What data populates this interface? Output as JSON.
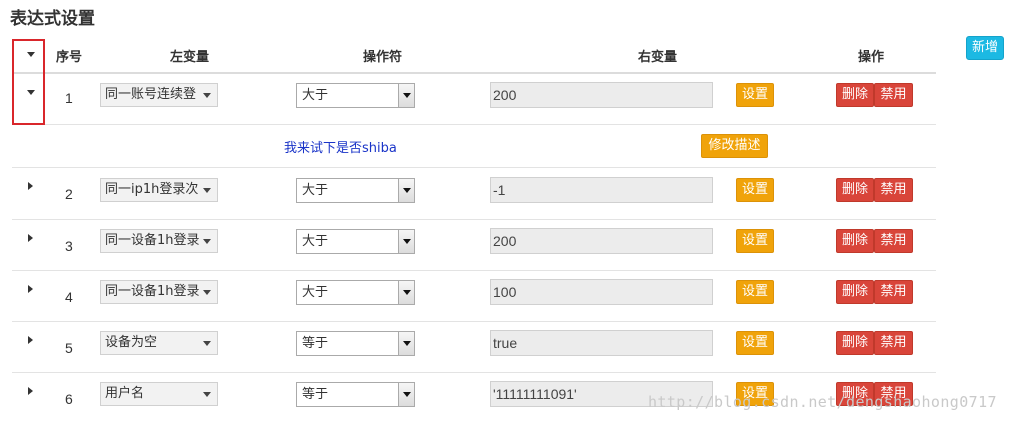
{
  "page": {
    "title": "表达式设置",
    "new_button": "新增"
  },
  "table": {
    "headers": {
      "index": "序号",
      "left": "左变量",
      "operator": "操作符",
      "right": "右变量",
      "action": "操作"
    },
    "rows": [
      {
        "index": "1",
        "left": "同一账号连续登",
        "operator": "大于",
        "right": "200",
        "expanded": true
      },
      {
        "index": "2",
        "left": "同一ip1h登录次",
        "operator": "大于",
        "right": "-1",
        "expanded": false
      },
      {
        "index": "3",
        "left": "同一设备1h登录",
        "operator": "大于",
        "right": "200",
        "expanded": false
      },
      {
        "index": "4",
        "left": "同一设备1h登录",
        "operator": "大于",
        "right": "100",
        "expanded": false
      },
      {
        "index": "5",
        "left": "设备为空",
        "operator": "等于",
        "right": "true",
        "expanded": false
      },
      {
        "index": "6",
        "left": "用户名",
        "operator": "等于",
        "right": "'11111111091'",
        "expanded": false
      }
    ],
    "description": {
      "text": "我来试下是否shiba",
      "edit_button": "修改描述"
    },
    "buttons": {
      "set": "设置",
      "delete": "删除",
      "disable": "禁用"
    }
  },
  "watermark": "http://blog.csdn.net/dengshaohong0717",
  "colors": {
    "info": "#1cb9e3",
    "warning": "#f0a30a",
    "danger": "#d9453a",
    "highlight": "#d9262b",
    "link": "#1a34c8"
  }
}
